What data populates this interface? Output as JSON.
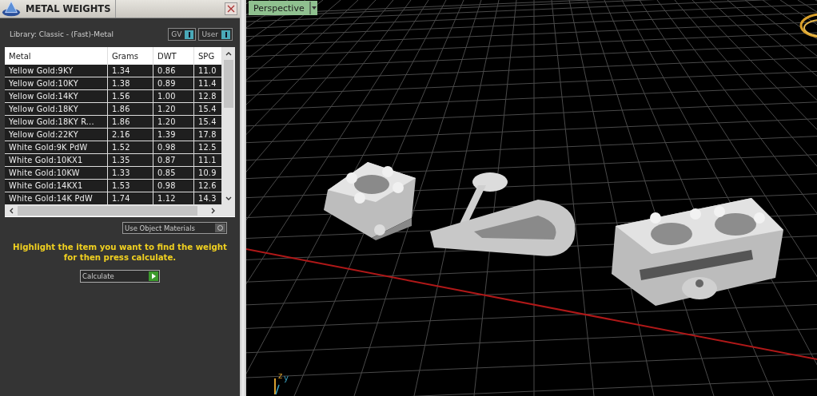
{
  "panel": {
    "title": "METAL WEIGHTS",
    "library": "Library: Classic - (Fast)-Metal",
    "toggles": [
      {
        "label": "GV",
        "on": true
      },
      {
        "label": "User",
        "on": true
      }
    ],
    "table": {
      "columns": [
        "Metal",
        "Grams",
        "DWT",
        "SPG"
      ],
      "rows": [
        [
          "Yellow Gold:9KY",
          "1.34",
          "0.86",
          "11.0"
        ],
        [
          "Yellow Gold:10KY",
          "1.38",
          "0.89",
          "11.4"
        ],
        [
          "Yellow Gold:14KY",
          "1.56",
          "1.00",
          "12.8"
        ],
        [
          "Yellow Gold:18KY",
          "1.86",
          "1.20",
          "15.4"
        ],
        [
          "Yellow Gold:18KY R...",
          "1.86",
          "1.20",
          "15.4"
        ],
        [
          "Yellow Gold:22KY",
          "2.16",
          "1.39",
          "17.8"
        ],
        [
          "White Gold:9K PdW",
          "1.52",
          "0.98",
          "12.5"
        ],
        [
          "White Gold:10KX1",
          "1.35",
          "0.87",
          "11.1"
        ],
        [
          "White Gold:10KW",
          "1.33",
          "0.85",
          "10.9"
        ],
        [
          "White Gold:14KX1",
          "1.53",
          "0.98",
          "12.6"
        ],
        [
          "White Gold:14K PdW",
          "1.74",
          "1.12",
          "14.3"
        ]
      ]
    },
    "use_object_materials": {
      "label": "Use Object Materials",
      "on": false
    },
    "hint": "Highlight the item you want to find the weight for then press calculate.",
    "calculate_button": "Calculate"
  },
  "viewport": {
    "view_menu": "Perspective",
    "axis_labels": [
      "z",
      "y"
    ]
  }
}
